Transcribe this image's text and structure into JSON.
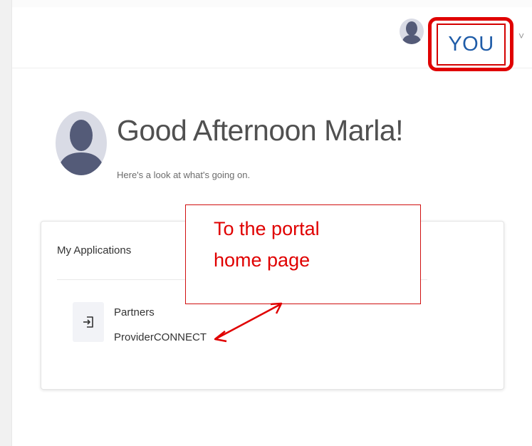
{
  "header": {
    "user_menu_label": "YOU",
    "caret_glyph": "˅",
    "avatar_icon": "person-silhouette-icon"
  },
  "greeting": {
    "title": "Good Afternoon Marla!",
    "subtitle": "Here's a look at what's going on.",
    "avatar_icon": "person-silhouette-icon"
  },
  "applications": {
    "title": "My Applications",
    "items": [
      {
        "line1": "Partners",
        "line2": "ProviderCONNECT",
        "icon": "sign-in-icon"
      }
    ]
  },
  "annotation": {
    "line1": "To the portal",
    "line2": "home page"
  },
  "colors": {
    "annotation_red": "#e00000",
    "you_blue": "#1f5ca8",
    "avatar_slate": "#545b78",
    "avatar_bg": "#d9dbe5"
  }
}
